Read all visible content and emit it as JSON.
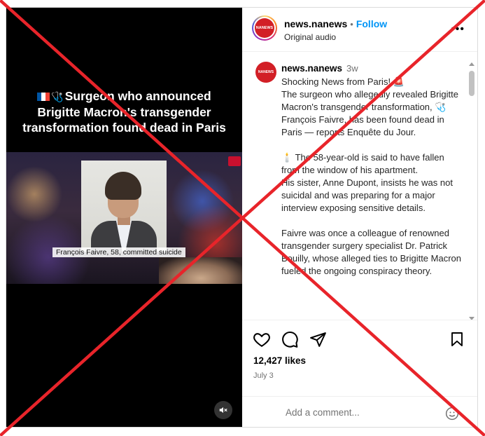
{
  "video": {
    "title": "Surgeon who announced Brigitte Macron's transgender transformation found dead in Paris",
    "caption": "François Faivre, 58, committed suicide",
    "title_icons": [
      "france-flag-icon",
      "stethoscope-icon"
    ]
  },
  "header": {
    "username": "news.nanews",
    "separator": "•",
    "follow_label": "Follow",
    "subtitle": "Original audio",
    "more_label": "•••",
    "avatar_text": "NANEWS"
  },
  "post": {
    "username": "news.nanews",
    "time": "3w",
    "text": "Shocking News from Paris! 🚨\nThe surgeon who allegedly revealed Brigitte Macron's transgender transformation, 🩺 François Faivre, has been found dead in Paris — reports Enquête du Jour.\n\n🕯️ The 58-year-old is said to have fallen from the window of his apartment.\nHis sister, Anne Dupont, insists he was not suicidal and was preparing for a major interview exposing sensitive details.\n\nFaivre was once a colleague of renowned transgender surgery specialist Dr. Patrick Bouilly, whose alleged ties to Brigitte Macron fueled the ongoing conspiracy theory."
  },
  "actions": {
    "likes": "12,427 likes",
    "date": "July 3"
  },
  "comment": {
    "placeholder": "Add a comment..."
  },
  "colors": {
    "accent": "#0095f6",
    "x_overlay": "#e8242a",
    "brand_red": "#d21f26"
  }
}
